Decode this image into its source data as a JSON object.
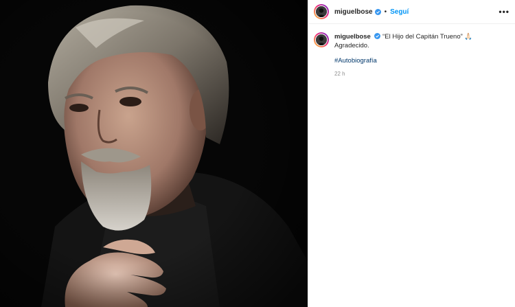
{
  "post": {
    "username": "miguelbose",
    "follow_label": "Seguí",
    "separator": "•",
    "more_label": "•••",
    "caption_text": "“El Hijo del Capitán Trueno” 🙏🏻 Agradecido.",
    "hashtag": "#Autobiografía",
    "time_ago": "22 h"
  },
  "colors": {
    "accent_link": "#0095f6",
    "hashtag": "#00376b",
    "verified": "#3897f0"
  },
  "icons": {
    "verified": "verified-badge-icon",
    "more": "more-options-icon"
  }
}
